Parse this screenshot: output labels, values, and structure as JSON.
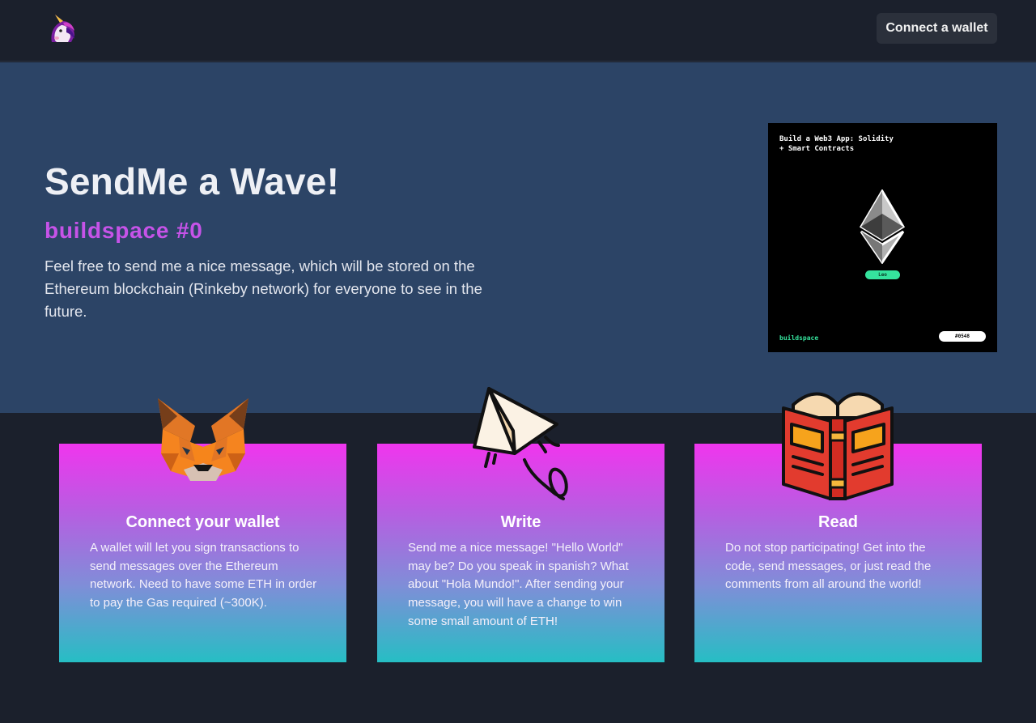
{
  "header": {
    "logo_icon": "unicorn-icon",
    "connect_button_label": "Connect a wallet"
  },
  "hero": {
    "title": "SendMe a Wave!",
    "subtitle": "buildspace #0",
    "description": "Feel free to send me a nice message, which will be stored on the Ethereum blockchain (Rinkeby network) for everyone to see in the future.",
    "nft": {
      "title": "Build a Web3 App: Solidity + Smart Contracts",
      "icon": "ethereum-icon",
      "pill": "Leo",
      "brand": "buildspace",
      "number": "#0548"
    }
  },
  "cards": [
    {
      "icon": "metamask-fox-icon",
      "title": "Connect your wallet",
      "text": "A wallet will let you sign transactions to send messages over the Ethereum network. Need to have some ETH in order to pay the Gas required (~300K)."
    },
    {
      "icon": "paper-plane-icon",
      "title": "Write",
      "text": "Send me a nice message! \"Hello World\" may be? Do you speak in spanish? What about \"Hola Mundo!\". After sending your message, you will have a change to win some small amount of ETH!"
    },
    {
      "icon": "open-book-icon",
      "title": "Read",
      "text": "Do not stop participating! Get into the code, send messages, or just read the comments from all around the world!"
    }
  ],
  "colors": {
    "background": "#1b202c",
    "hero_background": "#2c4466",
    "subtitle": "#c653e8",
    "card_gradient_top": "#f035ee",
    "card_gradient_bottom": "#26bec4",
    "nft_accent": "#35e39d"
  }
}
